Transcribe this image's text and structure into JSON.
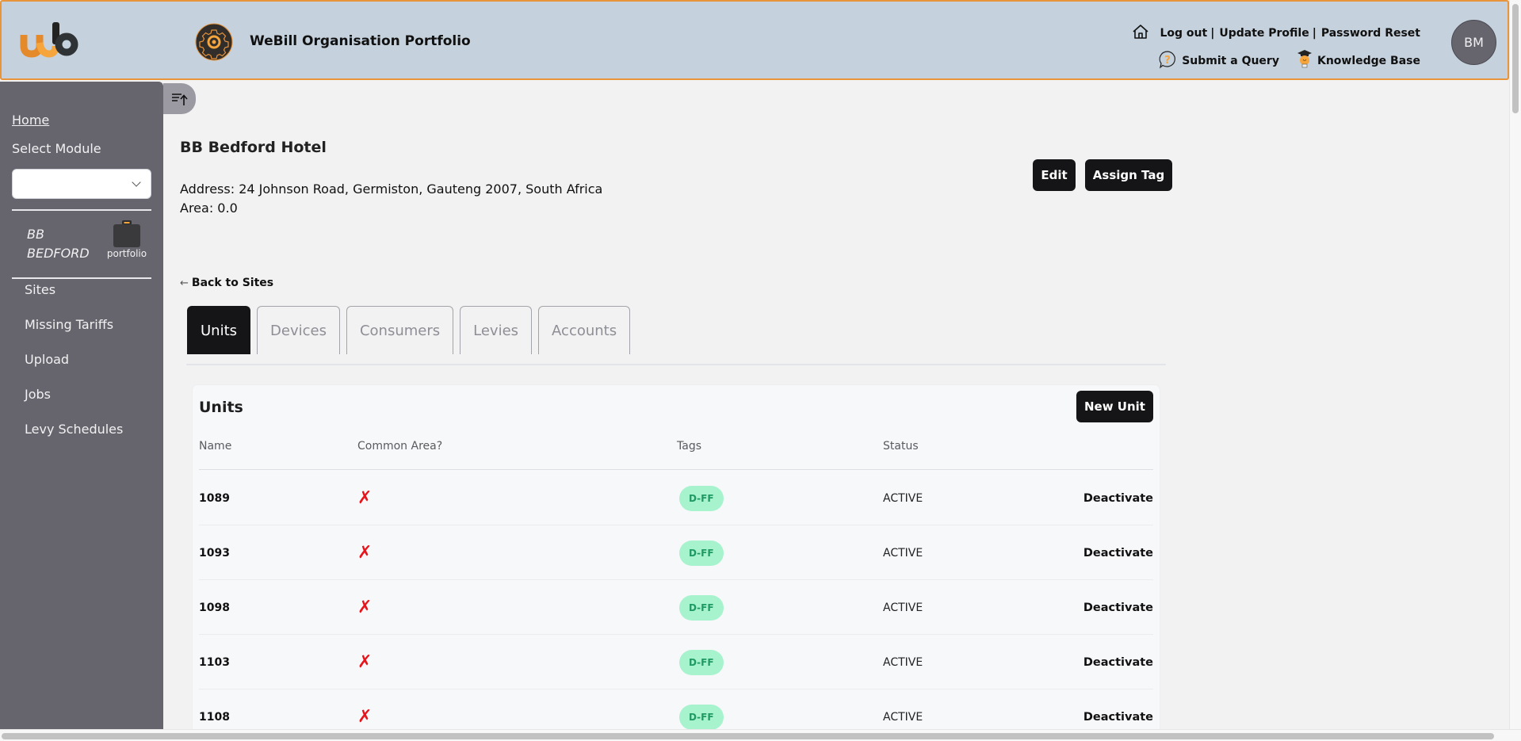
{
  "header": {
    "app_title": "WeBill Organisation Portfolio",
    "links_row1": [
      "Log out",
      "Update Profile",
      "Password Reset"
    ],
    "link_separator": "|",
    "submit_query": "Submit a Query",
    "knowledge_base": "Knowledge Base",
    "avatar_initials": "BM",
    "colors": {
      "header_bg": "#c5d1dc",
      "accent": "#e8943a"
    }
  },
  "sidebar": {
    "home": "Home",
    "select_module_label": "Select Module",
    "select_module_value": "",
    "org_name_line1": "BB",
    "org_name_line2": "BEDFORD",
    "portfolio_label": "portfolio",
    "items": [
      {
        "label": "Sites"
      },
      {
        "label": "Missing Tariffs"
      },
      {
        "label": "Upload"
      },
      {
        "label": "Jobs"
      },
      {
        "label": "Levy Schedules"
      }
    ]
  },
  "site": {
    "title": "BB Bedford Hotel",
    "address": "Address: 24 Johnson Road, Germiston, Gauteng 2007, South Africa",
    "area": "Area: 0.0",
    "edit_label": "Edit",
    "assign_tag_label": "Assign Tag",
    "back_label": "Back to Sites"
  },
  "tabs": [
    {
      "label": "Units",
      "active": true
    },
    {
      "label": "Devices",
      "active": false
    },
    {
      "label": "Consumers",
      "active": false
    },
    {
      "label": "Levies",
      "active": false
    },
    {
      "label": "Accounts",
      "active": false
    }
  ],
  "units": {
    "title": "Units",
    "new_label": "New Unit",
    "columns": [
      "Name",
      "Common Area?",
      "Tags",
      "Status",
      ""
    ],
    "rows": [
      {
        "name": "1089",
        "common_area": false,
        "common_icon": "✗",
        "tag": "D-FF",
        "status": "ACTIVE",
        "action": "Deactivate"
      },
      {
        "name": "1093",
        "common_area": false,
        "common_icon": "✗",
        "tag": "D-FF",
        "status": "ACTIVE",
        "action": "Deactivate"
      },
      {
        "name": "1098",
        "common_area": false,
        "common_icon": "✗",
        "tag": "D-FF",
        "status": "ACTIVE",
        "action": "Deactivate"
      },
      {
        "name": "1103",
        "common_area": false,
        "common_icon": "✗",
        "tag": "D-FF",
        "status": "ACTIVE",
        "action": "Deactivate"
      },
      {
        "name": "1108",
        "common_area": false,
        "common_icon": "✗",
        "tag": "D-FF",
        "status": "ACTIVE",
        "action": "Deactivate"
      }
    ]
  }
}
